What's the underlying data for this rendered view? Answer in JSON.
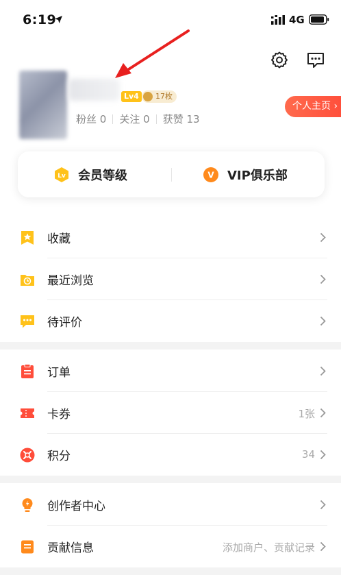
{
  "status_bar": {
    "time": "6:19",
    "network": "4G"
  },
  "profile": {
    "level": "Lv4",
    "coins": "17枚",
    "stats": [
      {
        "label": "粉丝",
        "value": "0"
      },
      {
        "label": "关注",
        "value": "0"
      },
      {
        "label": "获赞",
        "value": "13"
      }
    ],
    "homepage_label": "个人主页"
  },
  "member": {
    "level_label": "会员等级",
    "level_icon_text": "Lv",
    "vip_label": "VIP俱乐部",
    "vip_icon_text": "V"
  },
  "group1": [
    {
      "label": "收藏",
      "icon": "star-bookmark-icon"
    },
    {
      "label": "最近浏览",
      "icon": "history-folder-icon"
    },
    {
      "label": "待评价",
      "icon": "comment-icon"
    }
  ],
  "group2": [
    {
      "label": "订单",
      "icon": "order-icon"
    },
    {
      "label": "卡券",
      "icon": "coupon-icon",
      "value": "1张"
    },
    {
      "label": "积分",
      "icon": "points-icon",
      "value": "34"
    }
  ],
  "group3": [
    {
      "label": "创作者中心",
      "icon": "creator-bulb-icon"
    },
    {
      "label": "贡献信息",
      "icon": "contribution-icon",
      "value": "添加商户、贡献记录"
    }
  ],
  "colors": {
    "accent_orange": "#ff8a1c",
    "gold": "#ffc21a",
    "red": "#ff4d3a",
    "annotation_red": "#e8201f"
  }
}
